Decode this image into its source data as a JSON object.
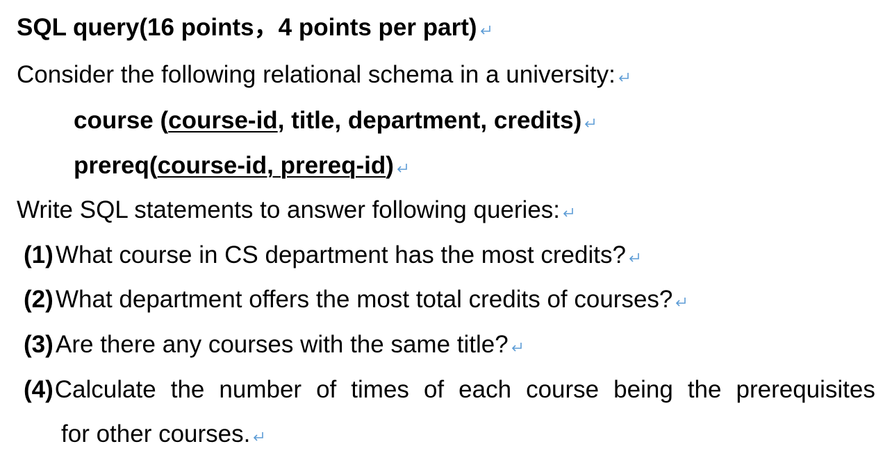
{
  "heading": "SQL query(16 points，4 points per part)",
  "intro": "Consider the following relational schema in a university:",
  "schema": {
    "course": {
      "name": "course (",
      "key": "course-id",
      "rest": ", title, department, credits)"
    },
    "prereq": {
      "name": "prereq(",
      "key": "course-id, prereq-id",
      "rest": ")"
    }
  },
  "instruction": "Write SQL statements to answer following queries:",
  "questions": [
    {
      "num": "(1)",
      "text": "What course in CS department has the most credits?"
    },
    {
      "num": "(2)",
      "text": "What department offers the most total credits of courses?"
    },
    {
      "num": "(3)",
      "text": "Are there any courses with the same title?"
    },
    {
      "num": "(4)",
      "text": "Calculate the number of times of each course being the prerequisites",
      "continuation": "for other courses."
    }
  ],
  "colors": {
    "text": "#000000",
    "return_mark": "#5b9bd5"
  },
  "icons": {
    "return_mark": "return-mark-icon"
  }
}
